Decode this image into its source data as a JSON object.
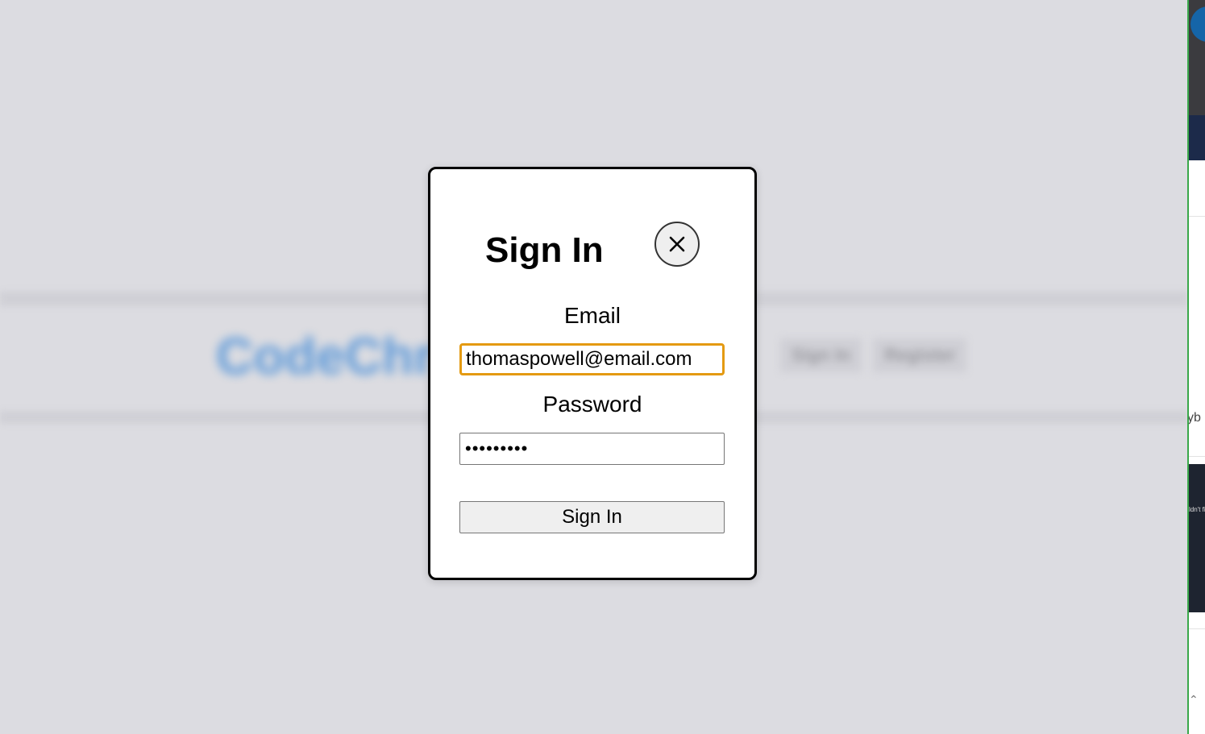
{
  "background": {
    "logo_text": "CodeChr",
    "nav_items": [
      "Sign In",
      "Register"
    ]
  },
  "side_panel": {
    "partial_text": "yb",
    "card_text": "ldn't fi"
  },
  "modal": {
    "title": "Sign In",
    "close_icon": "close-icon",
    "email_label": "Email",
    "email_value": "thomaspowell@email.com",
    "password_label": "Password",
    "password_value": "123456789",
    "submit_label": "Sign In"
  },
  "colors": {
    "focus_border": "#e49a12",
    "overlay_background": "#dcdce1"
  }
}
